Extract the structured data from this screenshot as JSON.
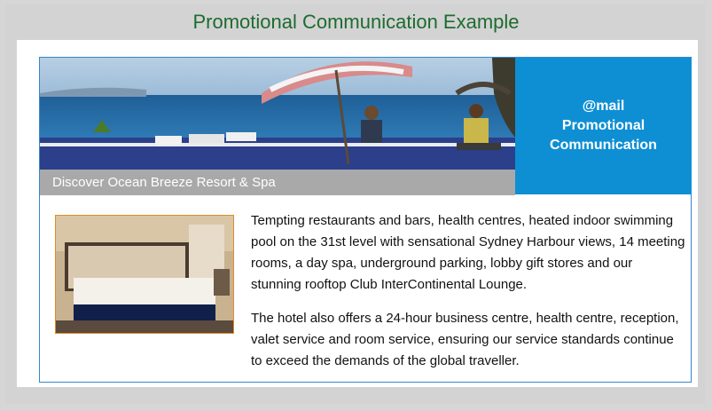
{
  "title": "Promotional Communication Example",
  "hero": {
    "caption": "Discover Ocean Breeze Resort & Spa",
    "image": "ocean-terrace-photo"
  },
  "badge": {
    "line1": "@mail",
    "line2": "Promotional",
    "line3": "Communication"
  },
  "thumbnail": {
    "image": "hotel-bedroom-photo"
  },
  "body": {
    "paragraph1": "Tempting restaurants and bars, health centres, heated indoor swimming pool on the 31st level with sensational Sydney Harbour views, 14 meeting rooms, a day spa, underground parking, lobby gift stores and our stunning rooftop Club InterContinental Lounge.",
    "paragraph2": "The hotel also offers a 24-hour business centre, health centre, reception, valet service and room service, ensuring our service standards continue to exceed the demands of the global traveller."
  },
  "colors": {
    "title": "#1e6b2f",
    "badge_bg": "#0e8fd3",
    "card_border": "#3a86c8",
    "caption_bg": "#a9a9aa",
    "thumb_border": "#e08b2a"
  }
}
